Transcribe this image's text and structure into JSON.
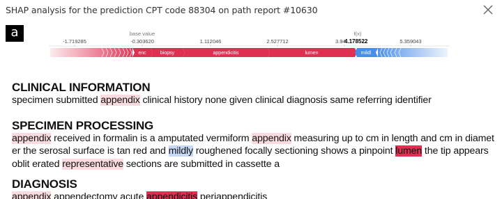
{
  "header": {
    "title": "SHAP analysis for the prediction CPT code 88304 on path report #10630"
  },
  "panel_label": "a",
  "force_plot": {
    "base_value_label": "base value",
    "fx_label": "f(x)",
    "fx_value": "4.178522",
    "ticks": [
      "-1.719285",
      "-0.303620",
      "1.112046",
      "2.527712",
      "3.94",
      "5.359043"
    ],
    "segments": {
      "enc": "enc",
      "biopsy": "biopsy",
      "appendicitis": "appendicitis",
      "lumen": "lumen",
      "mildl": "mildl"
    },
    "colors": {
      "positive": "#df3052",
      "negative": "#4a8de8"
    }
  },
  "report": {
    "clinical": {
      "heading": "CLINICAL INFORMATION",
      "t1": "specimen submitted ",
      "w_appendix": "appendix",
      "t2": " clinical history none given clinical diagnosis same referring identifier"
    },
    "specimen": {
      "heading": "SPECIMEN PROCESSING",
      "w_appendix1": "appendix",
      "t1": " received in formalin is a amputated vermiform ",
      "w_appendix2": "appendix",
      "t2": " measuring up to cm in length and cm in diamet er the serosal surface is tan red and ",
      "w_mildly": "mildly",
      "t3": " roughened focally sectioning shows a pinpoint ",
      "w_lumen": "lumen",
      "t4": " the tip appears oblit erated ",
      "w_representative": "representative",
      "t5": " sections are submitted in cassette a"
    },
    "diagnosis": {
      "heading": "DIAGNOSIS",
      "w_appendix": "appendix",
      "t1": " appendectomy acute ",
      "w_appendicitis": "appendicitis",
      "t2": " periappendicitis"
    }
  }
}
